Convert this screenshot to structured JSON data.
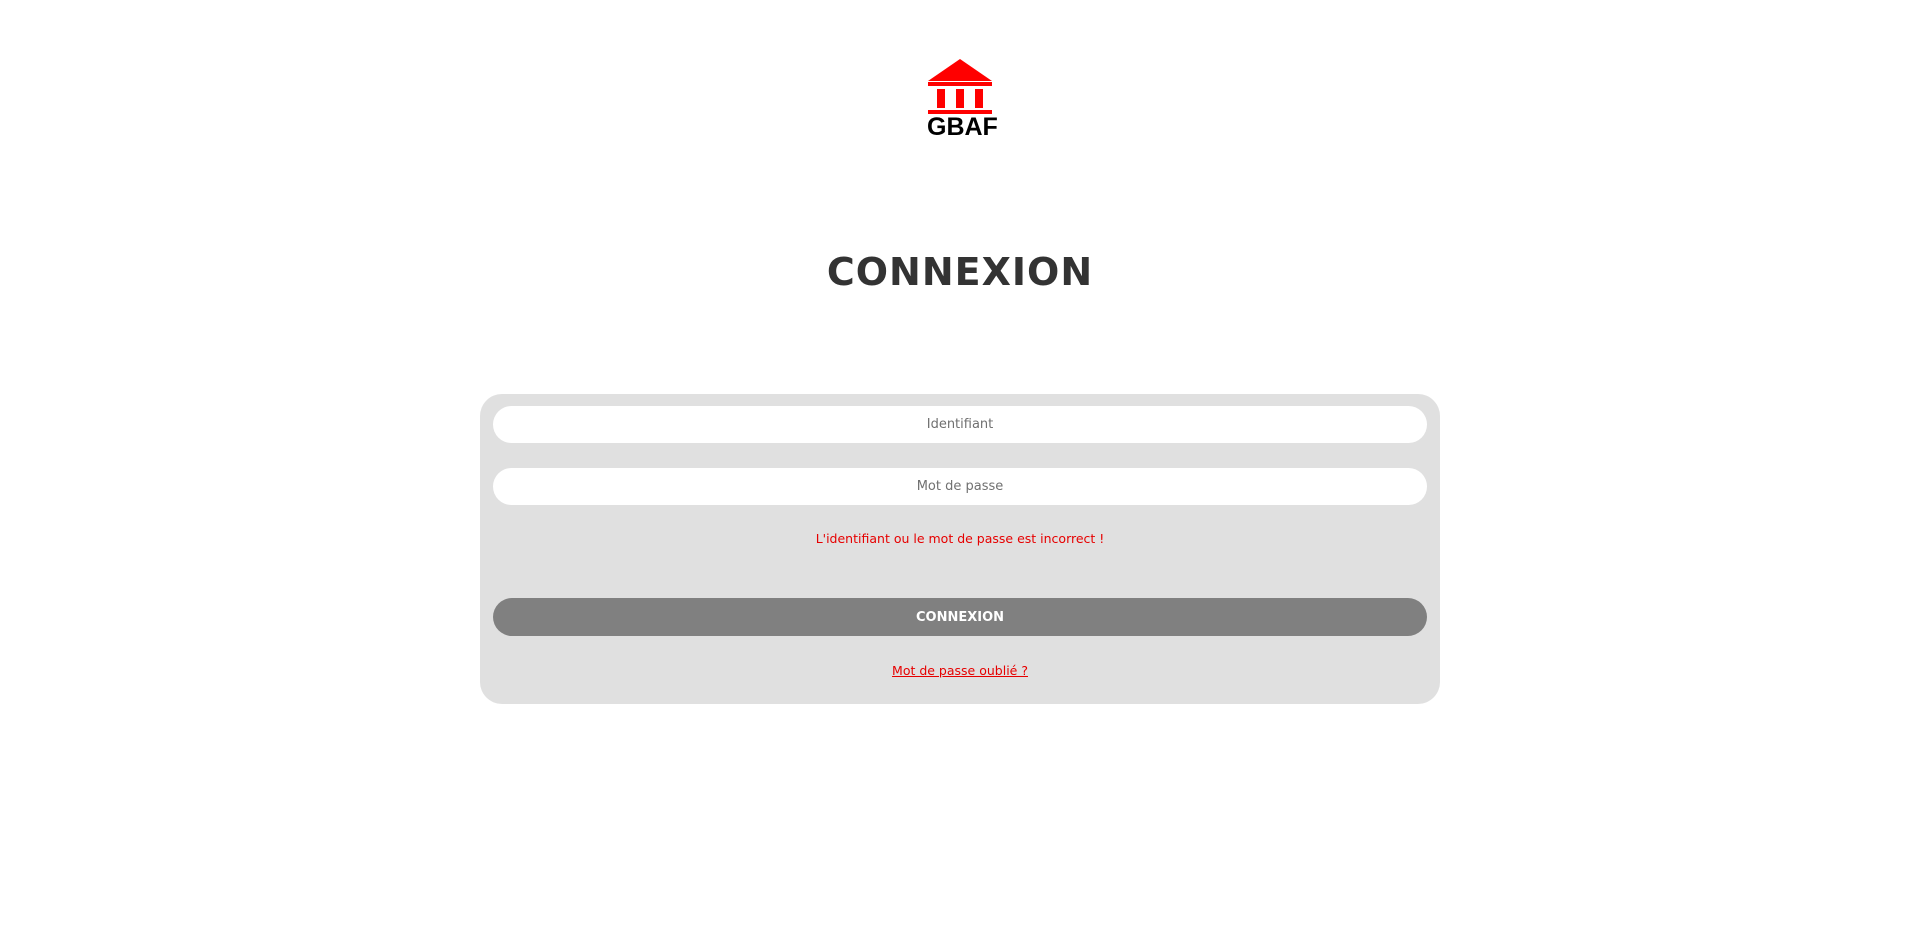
{
  "logo": {
    "text": "GBAF",
    "icon": "bank-building-icon",
    "color": "#ff0000"
  },
  "page": {
    "title": "CONNEXION"
  },
  "form": {
    "username_placeholder": "Identifiant",
    "username_value": "",
    "password_placeholder": "Mot de passe",
    "password_value": "",
    "error_message": "L'identifiant ou le mot de passe est incorrect !",
    "submit_label": "CONNEXION",
    "forgot_password_label": "Mot de passe oublié ?"
  },
  "colors": {
    "accent": "#e60000",
    "card_background": "#e0e0e0",
    "button_background": "#808080",
    "title_color": "#333333"
  }
}
